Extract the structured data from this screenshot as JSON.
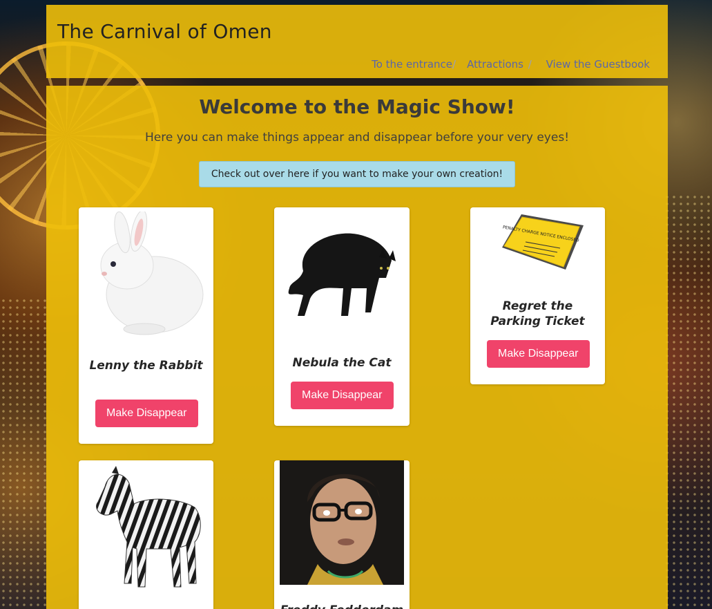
{
  "header": {
    "title": "The Carnival of Omen",
    "breadcrumb": [
      {
        "label": "To the entrance"
      },
      {
        "label": "Attractions"
      },
      {
        "label": "View the Guestbook"
      }
    ],
    "separator": "/"
  },
  "main": {
    "heading": "Welcome to the Magic Show!",
    "subtitle": "Here you can make things appear and disappear before your very eyes!",
    "create_link": "Check out over here if you want to make your own creation!"
  },
  "cards": [
    {
      "name": "Lenny the Rabbit",
      "button": "Make Disappear",
      "image": "white-rabbit"
    },
    {
      "name": "Nebula the Cat",
      "button": "Make Disappear",
      "image": "black-cat"
    },
    {
      "name": "Regret the Parking Ticket",
      "button": "Make Disappear",
      "image": "parking-ticket",
      "ticket_text": "PENALTY CHARGE NOTICE ENCLOSED"
    },
    {
      "name": "",
      "button": "",
      "image": "zebra"
    },
    {
      "name": "Freddy Fedderdam",
      "button": "",
      "image": "man-with-glasses"
    }
  ],
  "colors": {
    "panel": "#eebf0a",
    "accent_button": "#f0436a",
    "link": "#5a66a8",
    "info_button": "#a9dbe8"
  }
}
